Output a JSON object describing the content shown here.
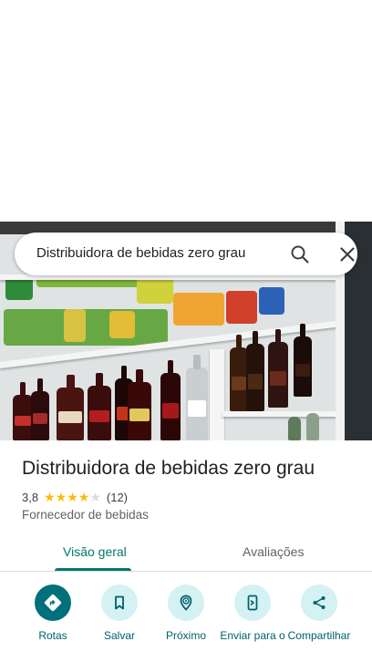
{
  "search": {
    "query": "Distribuidora de bebidas zero grau"
  },
  "place": {
    "name": "Distribuidora de bebidas zero grau",
    "rating": "3,8",
    "stars_filled": 4,
    "stars_total": 5,
    "review_count": "(12)",
    "category": "Fornecedor de bebidas"
  },
  "tabs": [
    {
      "label": "Visão geral",
      "active": true
    },
    {
      "label": "Avaliações",
      "active": false
    }
  ],
  "actions": [
    {
      "label": "Rotas",
      "icon": "directions-icon"
    },
    {
      "label": "Salvar",
      "icon": "bookmark-icon"
    },
    {
      "label": "Próximo",
      "icon": "nearby-icon"
    },
    {
      "label": "Enviar para o",
      "icon": "send-to-phone-icon"
    },
    {
      "label": "Compartilhar",
      "icon": "share-icon"
    }
  ],
  "colors": {
    "accent": "#00796b",
    "action_primary": "#00707a",
    "action_bg": "#d4f1f4",
    "star": "#fbbc04",
    "star_empty": "#dadce0"
  }
}
